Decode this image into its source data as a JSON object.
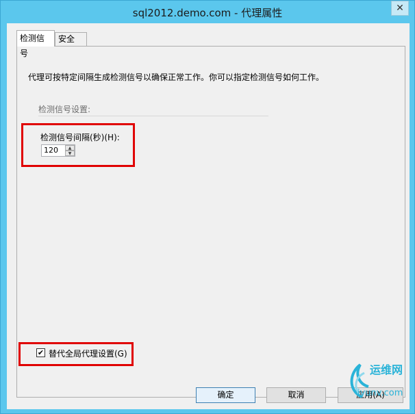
{
  "window": {
    "title": "sql2012.demo.com - 代理属性",
    "close_glyph": "✕"
  },
  "tabs": [
    {
      "label": "检测信号",
      "active": true
    },
    {
      "label": "安全",
      "active": false
    }
  ],
  "panel": {
    "description": "代理可按特定间隔生成检测信号以确保正常工作。你可以指定检测信号如何工作。",
    "section_label": "检测信号设置:",
    "interval_label": "检测信号间隔(秒)(H):",
    "interval_value": "120",
    "override_label": "替代全局代理设置(G)",
    "override_checked": true
  },
  "buttons": {
    "ok": "确定",
    "cancel": "取消",
    "apply": "应用(A)"
  },
  "watermark": {
    "brand": "运维网",
    "site": "iyunv.com"
  },
  "colors": {
    "titlebar": "#5bc7ed",
    "highlight": "#e00000",
    "client": "#f0f0f0"
  }
}
